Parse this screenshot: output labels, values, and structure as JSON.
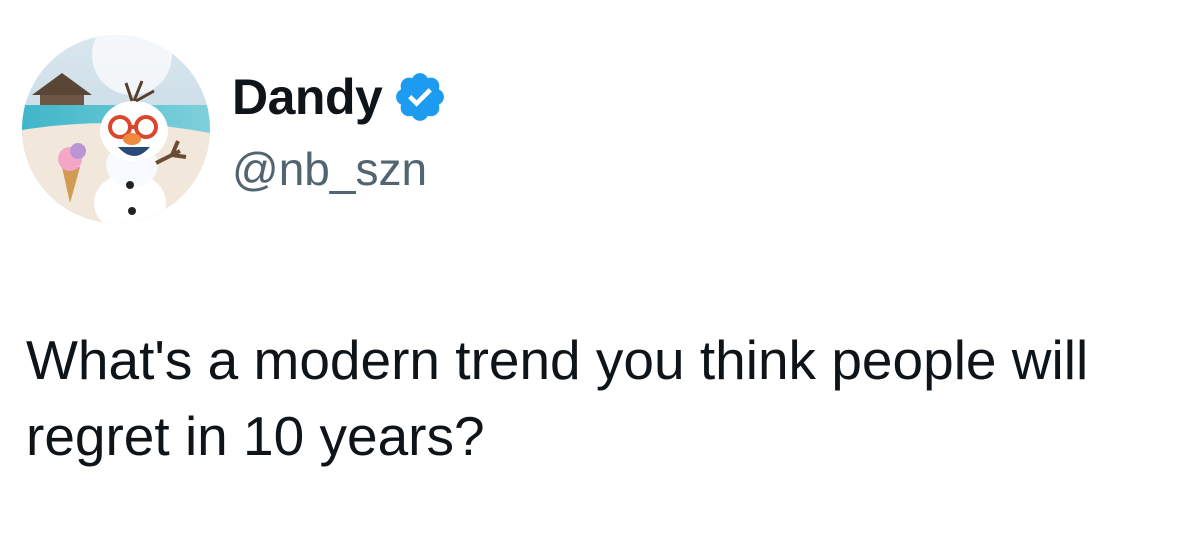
{
  "author": {
    "display_name": "Dandy",
    "handle": "@nb_szn",
    "verified": true,
    "avatar_icon": "avatar-image",
    "verified_icon": "verified-badge-icon",
    "verified_color": "#1d9bf0"
  },
  "tweet": {
    "text": "What's a modern trend you think people will regret in 10 years?"
  },
  "colors": {
    "text_primary": "#0f1419",
    "text_secondary": "#536471",
    "background": "#ffffff"
  }
}
